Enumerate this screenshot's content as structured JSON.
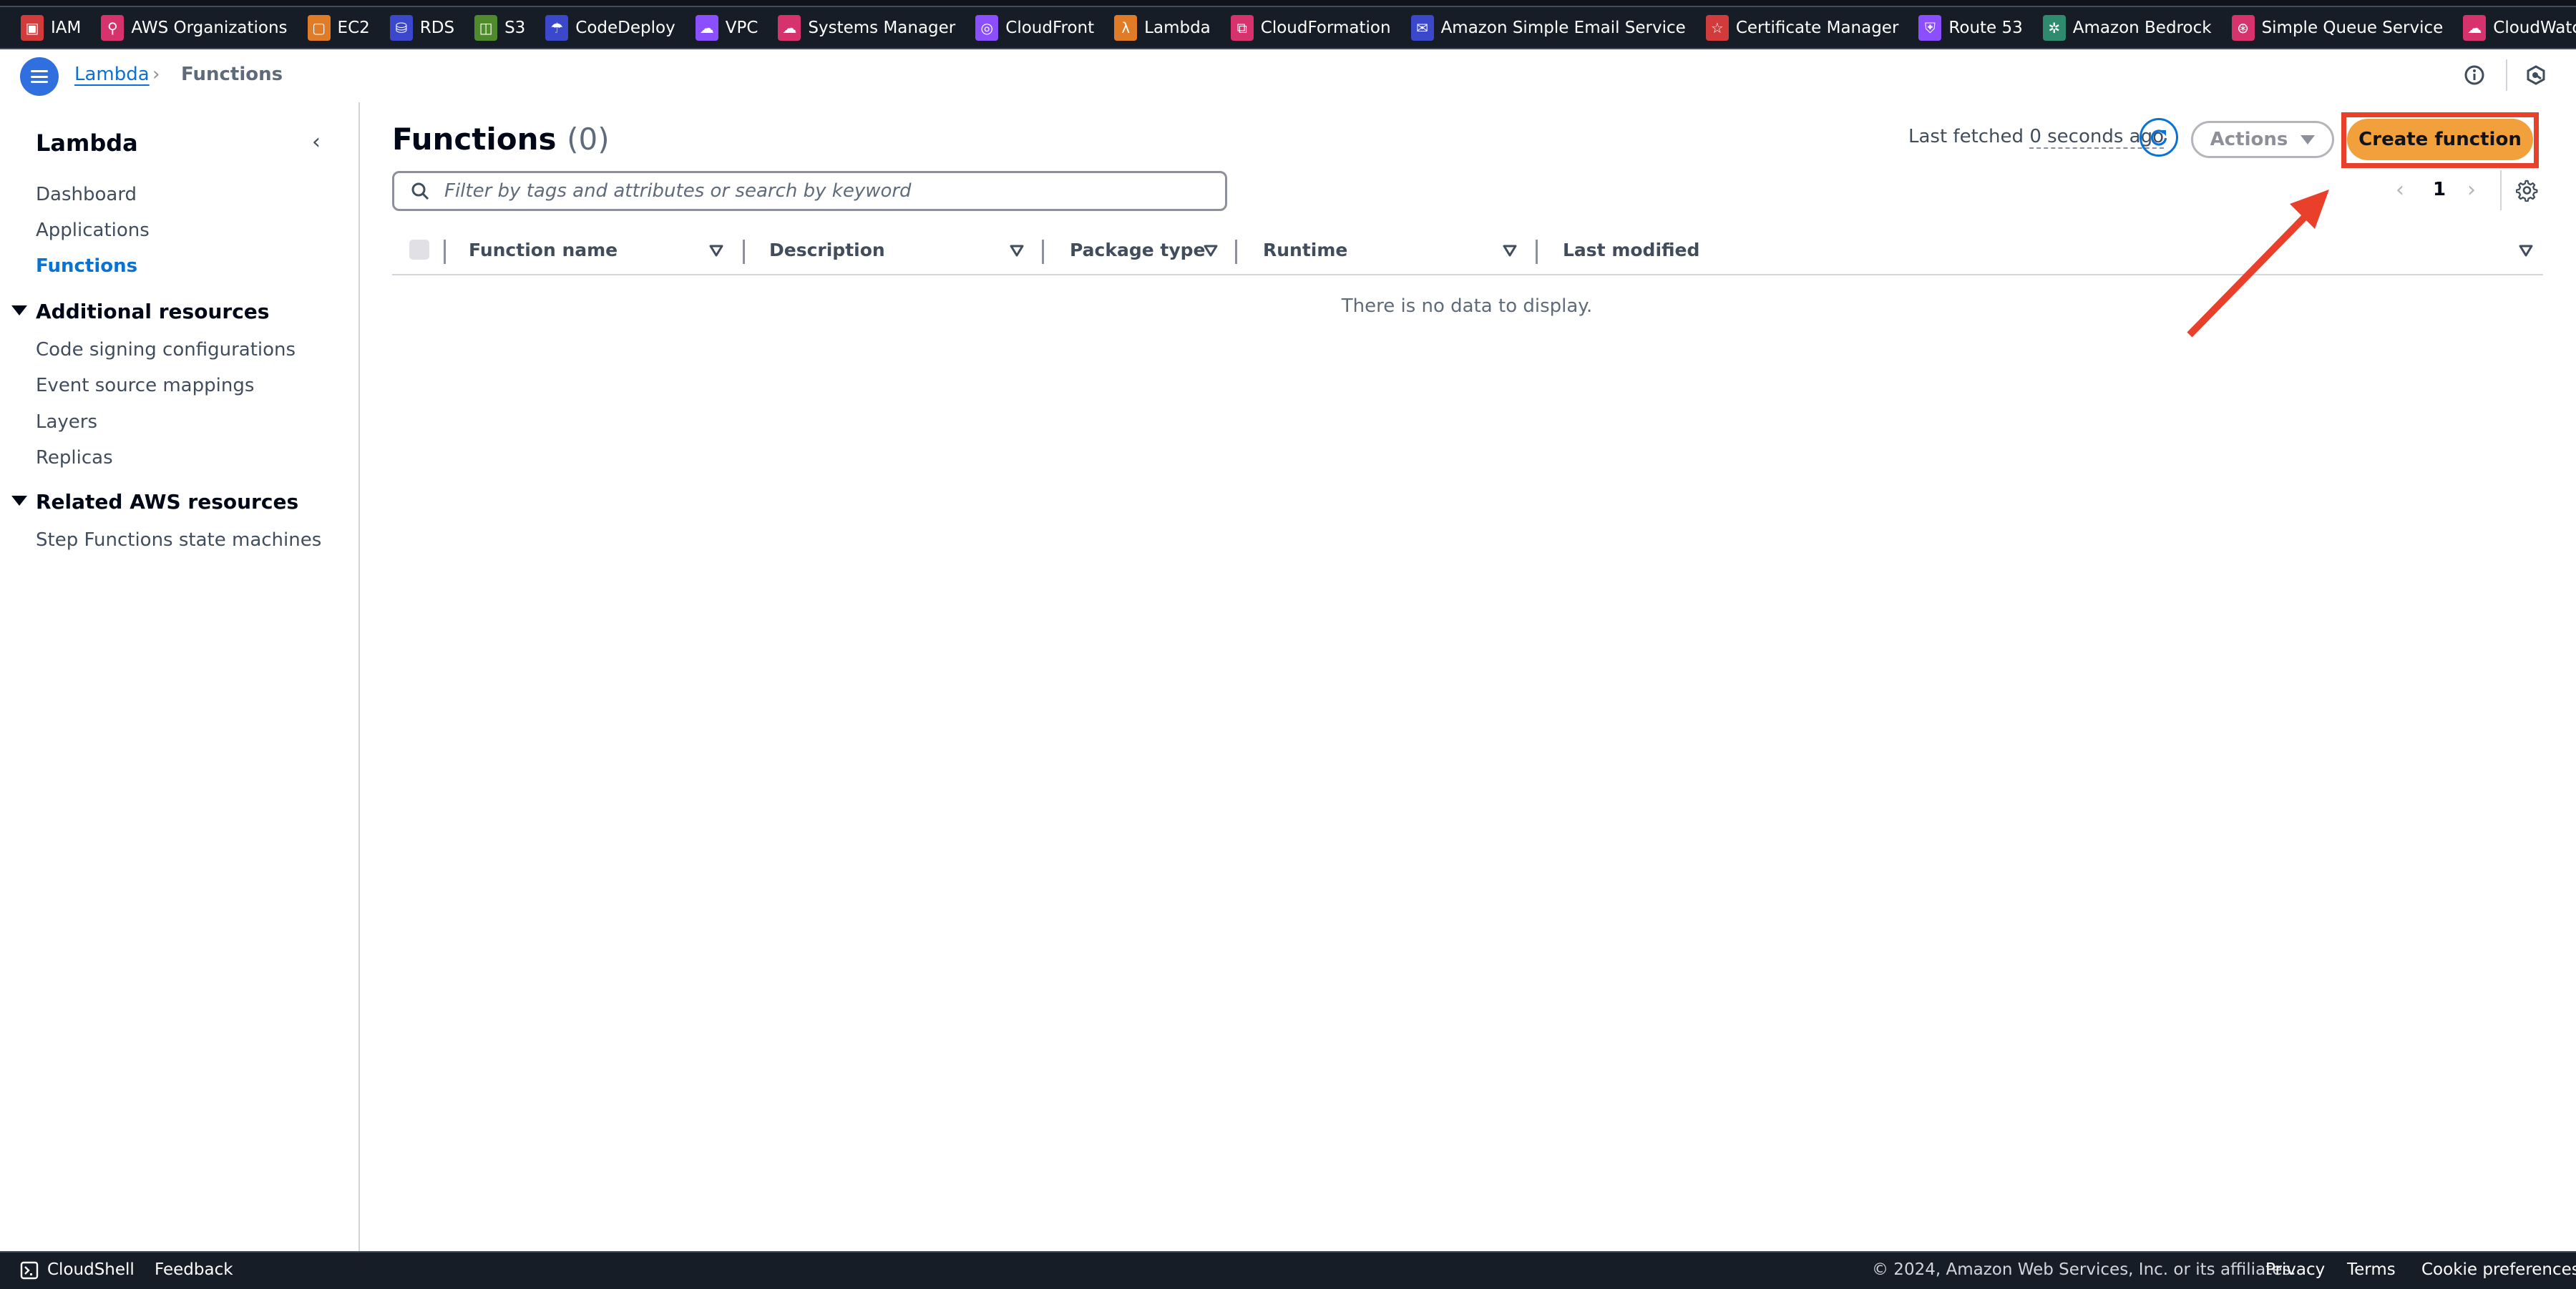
{
  "shortcuts": [
    {
      "label": "IAM",
      "icon": "iam-icon",
      "color": "#d13b3b",
      "glyph": "▣"
    },
    {
      "label": "AWS Organizations",
      "icon": "organizations-icon",
      "color": "#d6336c",
      "glyph": "⚲"
    },
    {
      "label": "EC2",
      "icon": "ec2-icon",
      "color": "#e07b28",
      "glyph": "▢"
    },
    {
      "label": "RDS",
      "icon": "rds-icon",
      "color": "#3b48cc",
      "glyph": "⛁"
    },
    {
      "label": "S3",
      "icon": "s3-icon",
      "color": "#4f8a2b",
      "glyph": "◫"
    },
    {
      "label": "CodeDeploy",
      "icon": "codedeploy-icon",
      "color": "#3b48cc",
      "glyph": "☂"
    },
    {
      "label": "VPC",
      "icon": "vpc-icon",
      "color": "#8c4fff",
      "glyph": "☁"
    },
    {
      "label": "Systems Manager",
      "icon": "systems-manager-icon",
      "color": "#d6336c",
      "glyph": "☁"
    },
    {
      "label": "CloudFront",
      "icon": "cloudfront-icon",
      "color": "#8c4fff",
      "glyph": "◎"
    },
    {
      "label": "Lambda",
      "icon": "lambda-icon",
      "color": "#e07b28",
      "glyph": "λ"
    },
    {
      "label": "CloudFormation",
      "icon": "cloudformation-icon",
      "color": "#d6336c",
      "glyph": "⧉"
    },
    {
      "label": "Amazon Simple Email Service",
      "icon": "ses-icon",
      "color": "#3b48cc",
      "glyph": "✉"
    },
    {
      "label": "Certificate Manager",
      "icon": "certificate-manager-icon",
      "color": "#d13b3b",
      "glyph": "☆"
    },
    {
      "label": "Route 53",
      "icon": "route53-icon",
      "color": "#8c4fff",
      "glyph": "⛨"
    },
    {
      "label": "Amazon Bedrock",
      "icon": "bedrock-icon",
      "color": "#2e8b6e",
      "glyph": "✲"
    },
    {
      "label": "Simple Queue Service",
      "icon": "sqs-icon",
      "color": "#d6336c",
      "glyph": "⊛"
    },
    {
      "label": "CloudWatch",
      "icon": "cloudwatch-icon",
      "color": "#d6336c",
      "glyph": "☁"
    }
  ],
  "breadcrumb": {
    "parent": "Lambda",
    "separator": "›",
    "current": "Functions"
  },
  "sidebar": {
    "title": "Lambda",
    "collapse_glyph": "‹",
    "items": [
      {
        "label": "Dashboard",
        "active": false
      },
      {
        "label": "Applications",
        "active": false
      },
      {
        "label": "Functions",
        "active": true
      }
    ],
    "sections": [
      {
        "title": "Additional resources",
        "expanded": true,
        "items": [
          "Code signing configurations",
          "Event source mappings",
          "Layers",
          "Replicas"
        ]
      },
      {
        "title": "Related AWS resources",
        "expanded": true,
        "items": [
          "Step Functions state machines"
        ]
      }
    ]
  },
  "main": {
    "title": "Functions",
    "count": "(0)",
    "last_fetched_prefix": "Last fetched",
    "last_fetched_value": "0 seconds ago",
    "actions_label": "Actions",
    "create_label": "Create function",
    "create_color": "#f2a03c",
    "highlight_color": "#e8402a",
    "search_placeholder": "Filter by tags and attributes or search by keyword",
    "search_value": "",
    "pagination": {
      "current_page": "1",
      "prev_glyph": "‹",
      "next_glyph": "›"
    },
    "table": {
      "columns": [
        "Function name",
        "Description",
        "Package type",
        "Runtime",
        "Last modified"
      ],
      "rows": [],
      "empty_message": "There is no data to display."
    }
  },
  "footer": {
    "cloudshell": "CloudShell",
    "feedback": "Feedback",
    "copyright": "© 2024, Amazon Web Services, Inc. or its affiliates.",
    "links": [
      "Privacy",
      "Terms",
      "Cookie preferences"
    ]
  }
}
